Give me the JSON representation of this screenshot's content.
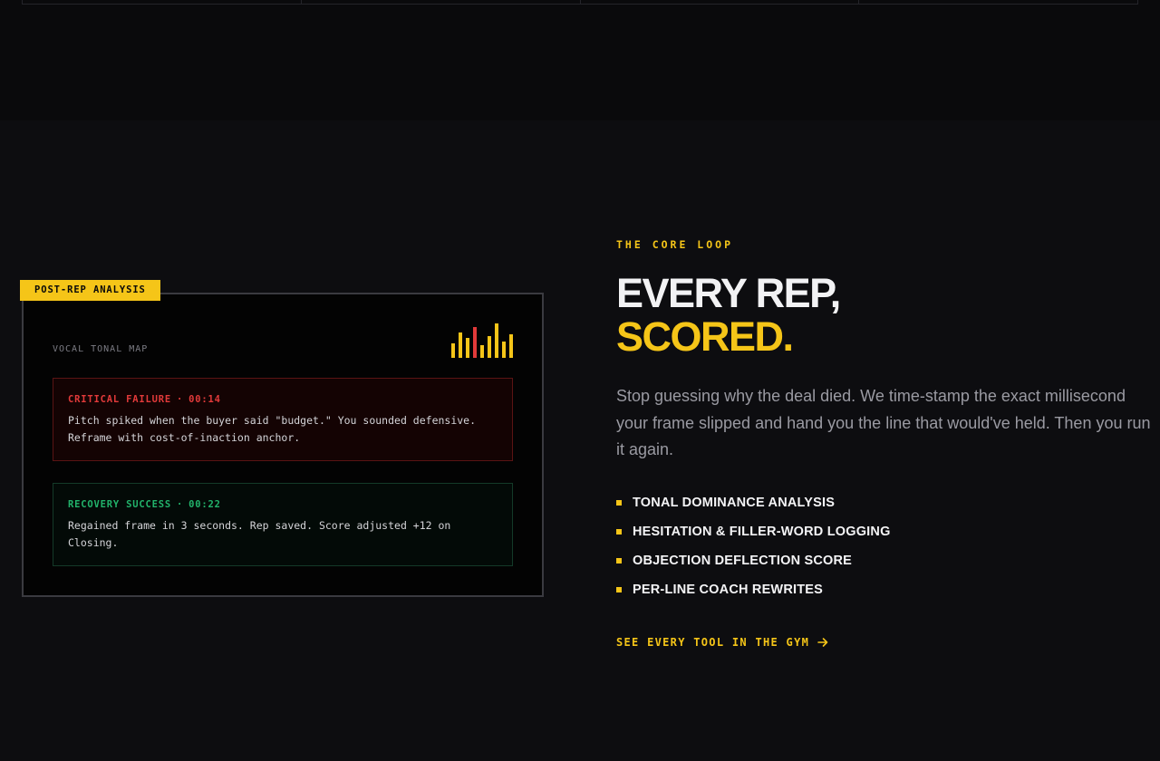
{
  "colors": {
    "accent": "#f5c518",
    "failure": "#e23a3a",
    "success": "#22b36b",
    "background": "#0d0d10"
  },
  "panel": {
    "tag": "POST-REP ANALYSIS",
    "vocal_label": "VOCAL TONAL MAP",
    "bars_icon": "audio-waveform-icon",
    "failure": {
      "label": "CRITICAL FAILURE",
      "separator": "·",
      "time": "00:14",
      "line1": "Pitch spiked when the buyer said \"budget.\" You sounded defensive.",
      "line2": "Reframe with cost-of-inaction anchor."
    },
    "success": {
      "label": "RECOVERY SUCCESS",
      "separator": "·",
      "time": "00:22",
      "line1": "Regained frame in 3 seconds. Rep saved. Score adjusted +12 on",
      "line2": "Closing."
    }
  },
  "section": {
    "eyebrow": "THE CORE LOOP",
    "headline_line1": "EVERY REP,",
    "headline_line2": "SCORED.",
    "lede": "Stop guessing why the deal died. We time-stamp the exact millisecond your frame slipped and hand you the line that would've held. Then you run it again.",
    "features": [
      "TONAL DOMINANCE ANALYSIS",
      "HESITATION & FILLER-WORD LOGGING",
      "OBJECTION DEFLECTION SCORE",
      "PER-LINE COACH REWRITES"
    ],
    "cta_label": "SEE EVERY TOOL IN THE GYM",
    "cta_icon": "arrow-right-icon"
  }
}
